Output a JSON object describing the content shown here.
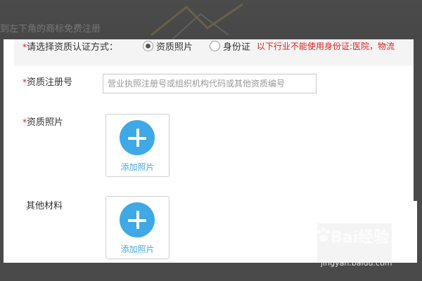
{
  "top_hint": "到左下角的商标免费注册",
  "required_mark": "*",
  "auth_method": {
    "label": "请选择资质认证方式：",
    "options": [
      {
        "label": "资质照片",
        "checked": true
      },
      {
        "label": "身份证",
        "checked": false
      }
    ],
    "warning": "以下行业不能使用身份证:医院，物流"
  },
  "registration_number": {
    "label": "资质注册号",
    "placeholder": "营业执照注册号或组织机构代码或其他资质编号"
  },
  "qualification_photo": {
    "label": "资质照片",
    "upload_text": "添加照片"
  },
  "other_materials": {
    "label": "其他材料",
    "upload_text": "添加照片"
  },
  "watermark": {
    "brand": "Bai经验",
    "site": "jingyan.baidu.com"
  },
  "colors": {
    "accent": "#3fa8e6",
    "required": "#e02020",
    "frame": "#4a4a4a"
  }
}
